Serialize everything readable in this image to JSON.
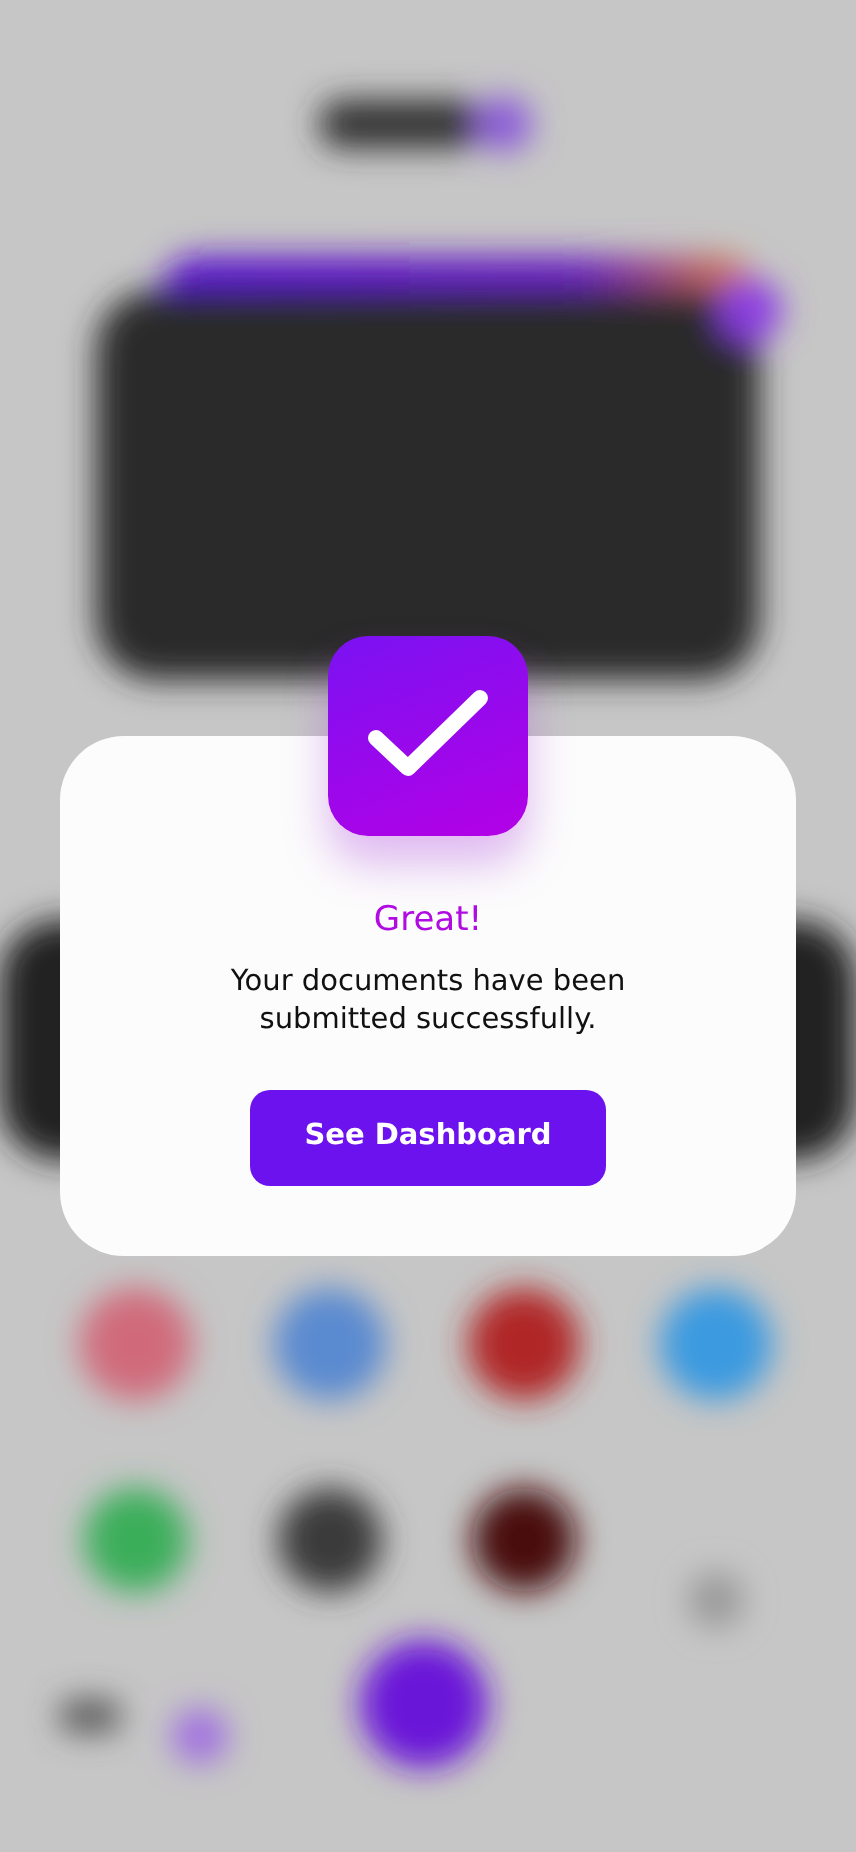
{
  "dialog": {
    "title": "Great!",
    "message": "Your documents have been submitted successfully.",
    "button": "See Dashboard"
  }
}
